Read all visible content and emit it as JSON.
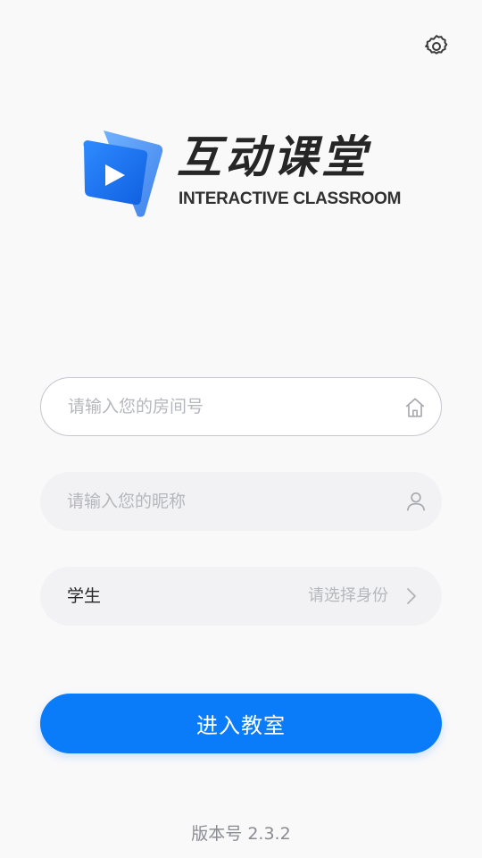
{
  "brand": {
    "title_cn": "互动课堂",
    "title_en": "INTERACTIVE CLASSROOM"
  },
  "form": {
    "room_placeholder": "请输入您的房间号",
    "nickname_placeholder": "请输入您的昵称",
    "role_value": "学生",
    "role_hint": "请选择身份",
    "submit_label": "进入教室"
  },
  "footer": {
    "version_text": "版本号 2.3.2"
  },
  "icons": {
    "settings": "gear-icon",
    "room": "home-icon",
    "nickname": "user-icon",
    "role": "chevron-right-icon"
  },
  "colors": {
    "primary": "#0a7cf9",
    "background": "#f9f9fa",
    "field_bg": "#f2f2f4",
    "placeholder": "#b5b7bd"
  }
}
